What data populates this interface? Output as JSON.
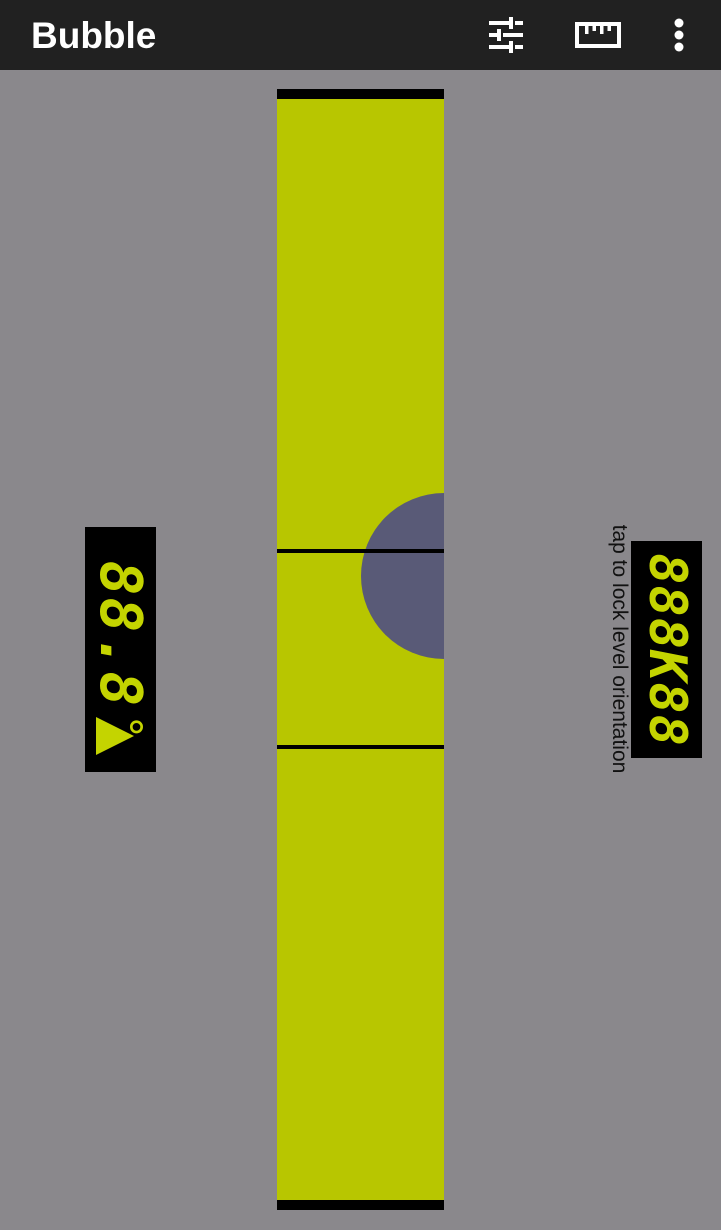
{
  "app_bar": {
    "title": "Bubble",
    "icons": [
      "tune-icon",
      "ruler-icon",
      "more-vert-icon"
    ]
  },
  "level": {
    "angle_display": "88.8",
    "angle_unit": "°",
    "lock_display": "888K88",
    "lock_hint": "tap to lock level orientation"
  },
  "colors": {
    "app_bar": "#212121",
    "background": "#8a888c",
    "tube": "#b8c600",
    "bubble": "#595a77",
    "lcd_text": "#c4d400",
    "lcd_background": "#000000"
  }
}
